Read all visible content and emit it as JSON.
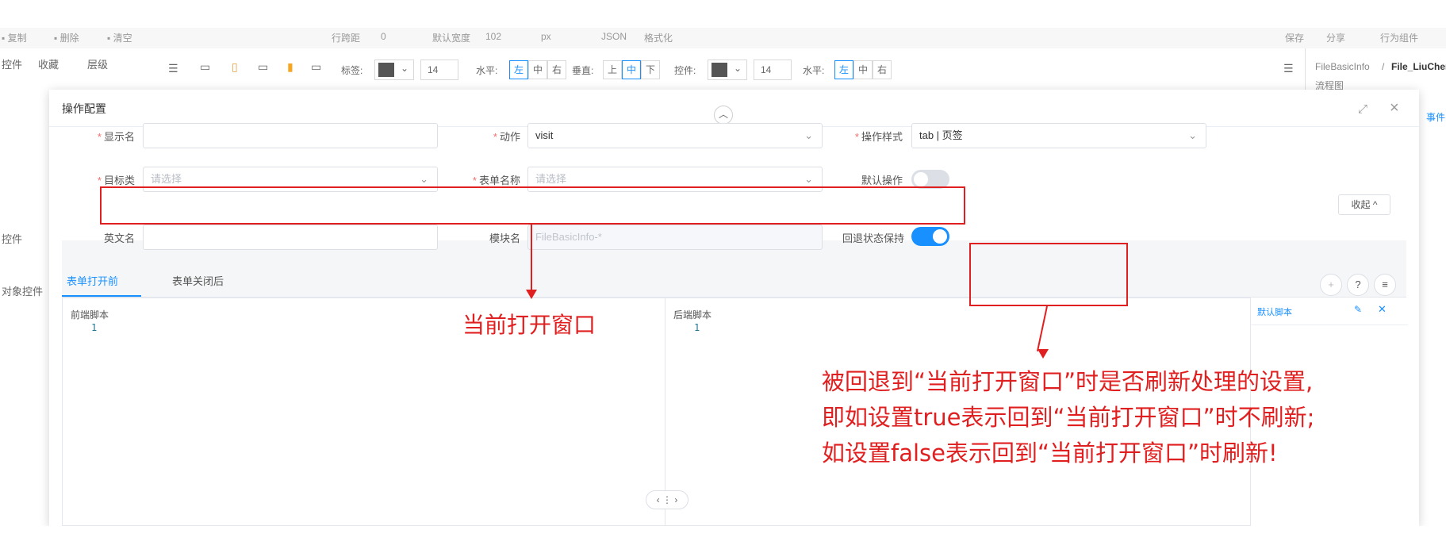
{
  "background": {
    "topbar": {
      "items": [
        "▪ 复制",
        "▪ 删除",
        "▪ 清空",
        "行跨距",
        "0",
        "默认宽度",
        "102",
        "px",
        "JSON",
        "格式化",
        "保存",
        "分享",
        "行为组件"
      ]
    },
    "left_panel": {
      "tabs": [
        "控件",
        "收藏",
        "层级"
      ],
      "sections": [
        "控件",
        "对象控件"
      ]
    },
    "toolbar": {
      "label_text": "标签:",
      "font_size": "14",
      "h_align_label": "水平:",
      "h_left": "左",
      "h_center": "中",
      "h_right": "右",
      "v_align_label": "垂直:",
      "v_top": "上",
      "v_middle": "中",
      "v_bottom": "下",
      "control_label": "控件:",
      "control_font_size": "14",
      "h2_label": "水平:",
      "h2_left": "左",
      "h2_center": "中",
      "h2_right": "右"
    },
    "right_panel": {
      "breadcrumb_a": "FileBasicInfo",
      "breadcrumb_sep": "/",
      "breadcrumb_b": "File_LiuCheng",
      "sub": "流程图",
      "tab_event": "事件"
    }
  },
  "modal": {
    "title": "操作配置",
    "fields": {
      "display_name": {
        "label": "显示名",
        "value": ""
      },
      "action": {
        "label": "动作",
        "value": "visit"
      },
      "op_style": {
        "label": "操作样式",
        "value": "tab | 页签"
      },
      "target_class": {
        "label": "目标类",
        "placeholder": "请选择"
      },
      "form_name": {
        "label": "表单名称",
        "placeholder": "请选择"
      },
      "default_op": {
        "label": "默认操作",
        "on": false
      },
      "english_name": {
        "label": "英文名",
        "value": ""
      },
      "module_name": {
        "label": "模块名",
        "value": "FileBasicInfo-*"
      },
      "back_state": {
        "label": "回退状态保持",
        "on": true
      }
    },
    "fold_button": "收起 ^",
    "tabs": [
      {
        "label": "表单打开前",
        "active": true
      },
      {
        "label": "表单关闭后",
        "active": false
      }
    ],
    "editors": {
      "front": {
        "title": "前端脚本",
        "line_no": "1"
      },
      "back": {
        "title": "后端脚本",
        "line_no": "1"
      }
    },
    "side_panel": {
      "title": "默认脚本"
    },
    "circle_buttons": [
      "+",
      "?",
      "≡"
    ]
  },
  "annotations": {
    "current_window": "当前打开窗口",
    "explain_lines": [
      "被回退到“当前打开窗口”时是否刷新处理的设置,",
      "即如设置true表示回到“当前打开窗口”时不刷新;",
      "如设置false表示回到“当前打开窗口”时刷新!"
    ],
    "color": "#e02020"
  },
  "colors": {
    "accent": "#1890ff",
    "required": "#f56c6c"
  }
}
